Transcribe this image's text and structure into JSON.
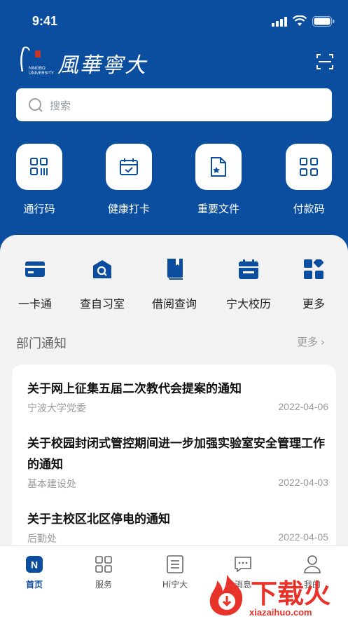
{
  "status_bar": {
    "time": "9:41"
  },
  "header": {
    "brand_text": "風華寧大"
  },
  "search": {
    "placeholder": "搜索"
  },
  "quick_actions": [
    {
      "label": "通行码",
      "icon": "qr-grid-icon"
    },
    {
      "label": "健康打卡",
      "icon": "calendar-check-icon"
    },
    {
      "label": "重要文件",
      "icon": "file-star-icon"
    },
    {
      "label": "付款码",
      "icon": "qr-code-icon"
    }
  ],
  "services": [
    {
      "label": "一卡通",
      "icon": "card-icon"
    },
    {
      "label": "查自习室",
      "icon": "search-room-icon"
    },
    {
      "label": "借阅查询",
      "icon": "book-icon"
    },
    {
      "label": "宁大校历",
      "icon": "calendar-icon"
    },
    {
      "label": "更多",
      "icon": "apps-more-icon"
    }
  ],
  "notices_section": {
    "title": "部门通知",
    "more": "更多"
  },
  "notices": [
    {
      "title": "关于网上征集五届二次教代会提案的通知",
      "source": "宁波大学党委",
      "date": "2022-04-06"
    },
    {
      "title": "关于校园封闭式管控期间进一步加强实验室安全管理工作的通知",
      "source": "基本建设处",
      "date": "2022-04-03"
    },
    {
      "title": "关于主校区北区停电的通知",
      "source": "后勤处",
      "date": "2022-04-05"
    }
  ],
  "tabs": [
    {
      "label": "首页",
      "active": true
    },
    {
      "label": "服务"
    },
    {
      "label": "Hi宁大"
    },
    {
      "label": "消息"
    },
    {
      "label": "我的"
    }
  ],
  "watermark": {
    "text": "下载火",
    "url": "xiazaihuo.com"
  },
  "colors": {
    "primary": "#0b4e9f",
    "accent_red": "#e8332a"
  }
}
